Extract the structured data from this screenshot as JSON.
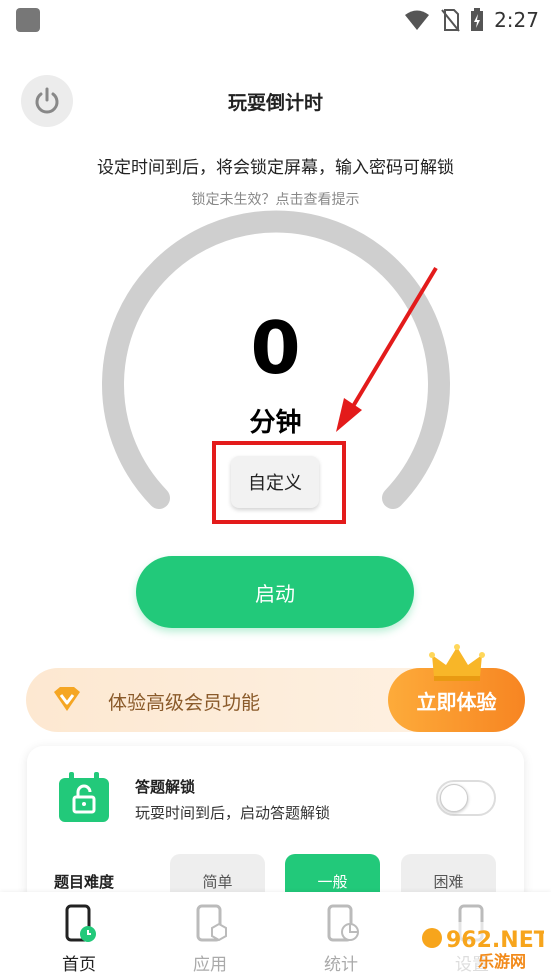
{
  "status_bar": {
    "time": "2:27"
  },
  "header": {
    "title": "玩耍倒计时"
  },
  "description": {
    "text": "设定时间到后，将会锁定屏幕，输入密码可解锁",
    "hint": "锁定未生效？点击查看提示"
  },
  "timer": {
    "value": "0",
    "unit": "分钟",
    "custom_label": "自定义"
  },
  "start_button": {
    "label": "启动"
  },
  "vip": {
    "text": "体验高级会员功能",
    "button_label": "立即体验"
  },
  "quiz": {
    "title": "答题解锁",
    "description": "玩耍时间到后，启动答题解锁",
    "enabled": false,
    "difficulty_label": "题目难度",
    "difficulties": [
      "简单",
      "一般",
      "困难"
    ],
    "selected_difficulty": "一般"
  },
  "nav": {
    "items": [
      {
        "label": "首页",
        "active": true
      },
      {
        "label": "应用",
        "active": false
      },
      {
        "label": "统计",
        "active": false
      },
      {
        "label": "设置",
        "active": false
      }
    ]
  },
  "watermark": {
    "brand": "962.NET",
    "sub": "乐游网"
  },
  "colors": {
    "primary": "#22c97a",
    "vip_orange": "#f78522",
    "annotation_red": "#e31b1b"
  }
}
